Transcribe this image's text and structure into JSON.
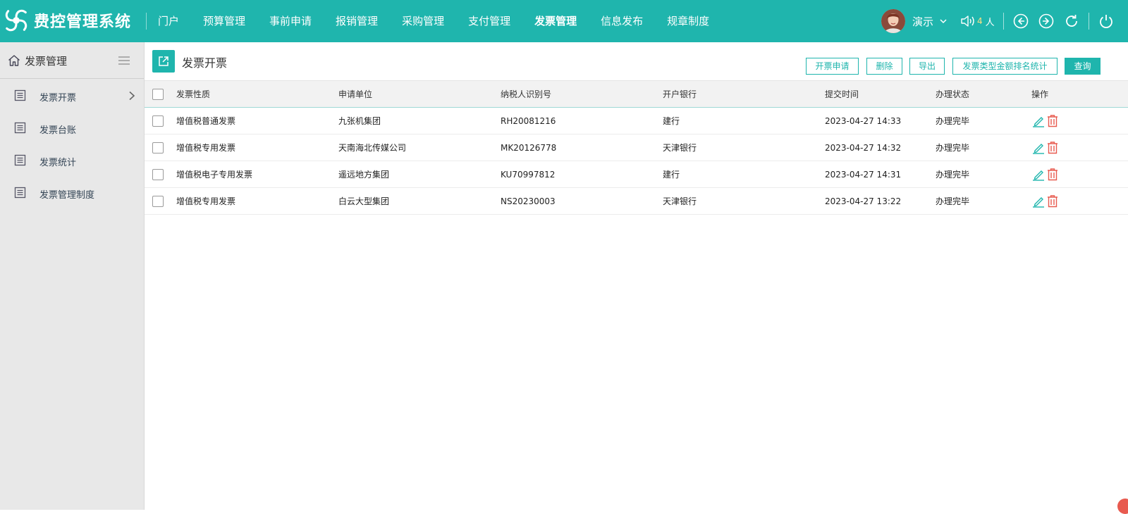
{
  "app": {
    "title": "费控管理系统"
  },
  "nav": {
    "items": [
      {
        "label": "门户"
      },
      {
        "label": "预算管理"
      },
      {
        "label": "事前申请"
      },
      {
        "label": "报销管理"
      },
      {
        "label": "采购管理"
      },
      {
        "label": "支付管理"
      },
      {
        "label": "发票管理",
        "active": true
      },
      {
        "label": "信息发布"
      },
      {
        "label": "规章制度"
      }
    ]
  },
  "header": {
    "user_name": "演示",
    "online_count": "4",
    "online_unit": "人"
  },
  "sidebar": {
    "title": "发票管理",
    "items": [
      {
        "label": "发票开票"
      },
      {
        "label": "发票台账"
      },
      {
        "label": "发票统计"
      },
      {
        "label": "发票管理制度"
      }
    ]
  },
  "page": {
    "title": "发票开票",
    "buttons": {
      "apply": "开票申请",
      "delete": "删除",
      "export": "导出",
      "stats": "发票类型金额排名统计",
      "query": "查询"
    }
  },
  "table": {
    "headers": [
      "发票性质",
      "申请单位",
      "纳税人识别号",
      "开户银行",
      "提交时间",
      "办理状态",
      "操作"
    ],
    "rows": [
      [
        "增值税普通发票",
        "九张机集团",
        "RH20081216",
        "建行",
        "2023-04-27 14:33",
        "办理完毕"
      ],
      [
        "增值税专用发票",
        "天南海北传媒公司",
        "MK20126778",
        "天津银行",
        "2023-04-27 14:32",
        "办理完毕"
      ],
      [
        "增值税电子专用发票",
        "遥远地方集团",
        "KU70997812",
        "建行",
        "2023-04-27 14:31",
        "办理完毕"
      ],
      [
        "增值税专用发票",
        "白云大型集团",
        "NS20230003",
        "天津银行",
        "2023-04-27 13:22",
        "办理完毕"
      ]
    ]
  },
  "colors": {
    "accent": "#1fb5ad",
    "danger": "#e85a4f",
    "sidebar_bg": "#e8e8e8"
  }
}
